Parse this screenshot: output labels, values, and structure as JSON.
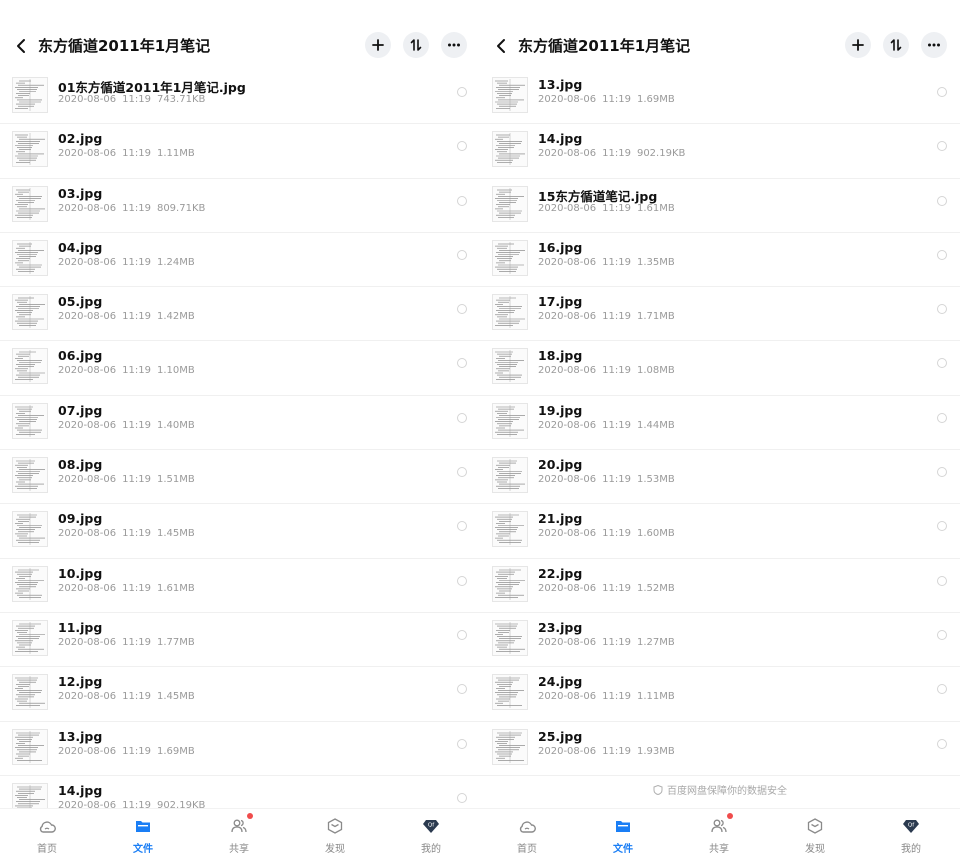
{
  "header": {
    "title": "东方循道2011年1月笔记"
  },
  "left_files": [
    {
      "name": "01东方循道2011年1月笔记.jpg",
      "date": "2020-08-06",
      "time": "11:19",
      "size": "743.71KB"
    },
    {
      "name": "02.jpg",
      "date": "2020-08-06",
      "time": "11:19",
      "size": "1.11MB"
    },
    {
      "name": "03.jpg",
      "date": "2020-08-06",
      "time": "11:19",
      "size": "809.71KB"
    },
    {
      "name": "04.jpg",
      "date": "2020-08-06",
      "time": "11:19",
      "size": "1.24MB"
    },
    {
      "name": "05.jpg",
      "date": "2020-08-06",
      "time": "11:19",
      "size": "1.42MB"
    },
    {
      "name": "06.jpg",
      "date": "2020-08-06",
      "time": "11:19",
      "size": "1.10MB"
    },
    {
      "name": "07.jpg",
      "date": "2020-08-06",
      "time": "11:19",
      "size": "1.40MB"
    },
    {
      "name": "08.jpg",
      "date": "2020-08-06",
      "time": "11:19",
      "size": "1.51MB"
    },
    {
      "name": "09.jpg",
      "date": "2020-08-06",
      "time": "11:19",
      "size": "1.45MB"
    },
    {
      "name": "10.jpg",
      "date": "2020-08-06",
      "time": "11:19",
      "size": "1.61MB"
    },
    {
      "name": "11.jpg",
      "date": "2020-08-06",
      "time": "11:19",
      "size": "1.77MB"
    },
    {
      "name": "12.jpg",
      "date": "2020-08-06",
      "time": "11:19",
      "size": "1.45MB"
    },
    {
      "name": "13.jpg",
      "date": "2020-08-06",
      "time": "11:19",
      "size": "1.69MB"
    },
    {
      "name": "14.jpg",
      "date": "2020-08-06",
      "time": "11:19",
      "size": "902.19KB"
    }
  ],
  "right_files": [
    {
      "name": "13.jpg",
      "date": "2020-08-06",
      "time": "11:19",
      "size": "1.69MB"
    },
    {
      "name": "14.jpg",
      "date": "2020-08-06",
      "time": "11:19",
      "size": "902.19KB"
    },
    {
      "name": "15东方循道笔记.jpg",
      "date": "2020-08-06",
      "time": "11:19",
      "size": "1.61MB"
    },
    {
      "name": "16.jpg",
      "date": "2020-08-06",
      "time": "11:19",
      "size": "1.35MB"
    },
    {
      "name": "17.jpg",
      "date": "2020-08-06",
      "time": "11:19",
      "size": "1.71MB"
    },
    {
      "name": "18.jpg",
      "date": "2020-08-06",
      "time": "11:19",
      "size": "1.08MB"
    },
    {
      "name": "19.jpg",
      "date": "2020-08-06",
      "time": "11:19",
      "size": "1.44MB"
    },
    {
      "name": "20.jpg",
      "date": "2020-08-06",
      "time": "11:19",
      "size": "1.53MB"
    },
    {
      "name": "21.jpg",
      "date": "2020-08-06",
      "time": "11:19",
      "size": "1.60MB"
    },
    {
      "name": "22.jpg",
      "date": "2020-08-06",
      "time": "11:19",
      "size": "1.52MB"
    },
    {
      "name": "23.jpg",
      "date": "2020-08-06",
      "time": "11:19",
      "size": "1.27MB"
    },
    {
      "name": "24.jpg",
      "date": "2020-08-06",
      "time": "11:19",
      "size": "1.11MB"
    },
    {
      "name": "25.jpg",
      "date": "2020-08-06",
      "time": "11:19",
      "size": "1.93MB"
    }
  ],
  "footer_note": "百度网盘保障你的数据安全",
  "tabs": [
    {
      "label": "首页",
      "icon": "cloud-icon"
    },
    {
      "label": "文件",
      "icon": "folder-icon"
    },
    {
      "label": "共享",
      "icon": "share-people-icon"
    },
    {
      "label": "发现",
      "icon": "discover-cube-icon"
    },
    {
      "label": "我的",
      "icon": "profile-diamond-icon"
    }
  ],
  "avatar_text": "Qf",
  "colors": {
    "accent": "#1a7ef5",
    "badge": "#f04b4b",
    "muted": "#9a9a9a"
  }
}
